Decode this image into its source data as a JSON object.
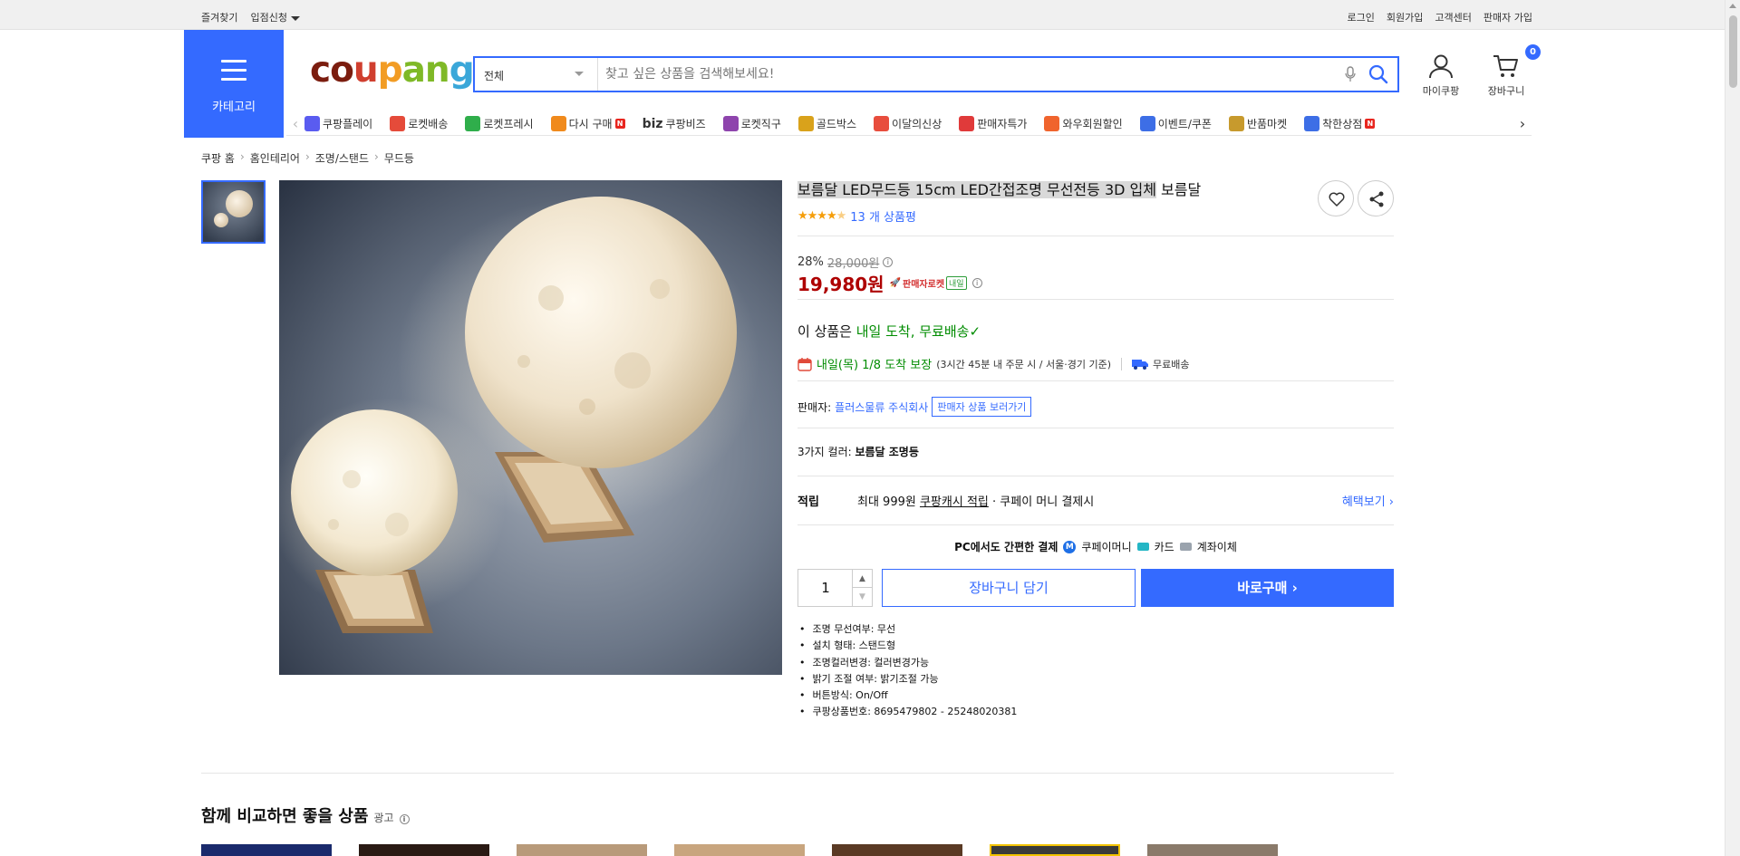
{
  "topbar": {
    "left": [
      "즐겨찾기",
      "입점신청"
    ],
    "right": [
      "로그인",
      "회원가입",
      "고객센터",
      "판매자 가입"
    ]
  },
  "header": {
    "category_label": "카테고리",
    "logo": {
      "c1": "co",
      "c2": "u",
      "c3": "p",
      "c4": "an",
      "c5": "g"
    },
    "search_category": "전체",
    "search_placeholder": "찾고 싶은 상품을 검색해보세요!",
    "my_coupang": "마이쿠팡",
    "cart": "장바구니",
    "cart_count": "0"
  },
  "shortcuts": [
    {
      "label": "쿠팡플레이",
      "icon": "play-icon",
      "color": "#5a5cf0"
    },
    {
      "label": "로켓배송",
      "icon": "rocket-icon",
      "color": "#e54b3a"
    },
    {
      "label": "로켓프레시",
      "icon": "rocket-fresh-icon",
      "color": "#2fae4b"
    },
    {
      "label": "다시 구매",
      "icon": "rebuy-icon",
      "color": "#f08a1c",
      "badge": "N"
    },
    {
      "label": "쿠팡비즈",
      "icon": "biz-icon",
      "color": "#333333",
      "biz": "biz"
    },
    {
      "label": "로켓직구",
      "icon": "rocket-global-icon",
      "color": "#8e44ad"
    },
    {
      "label": "골드박스",
      "icon": "goldbox-icon",
      "color": "#d9a21b"
    },
    {
      "label": "이달의신상",
      "icon": "new-icon",
      "color": "#e84d3d"
    },
    {
      "label": "판매자특가",
      "icon": "percent-icon",
      "color": "#e03a3a"
    },
    {
      "label": "와우회원할인",
      "icon": "wow-icon",
      "color": "#f0642d"
    },
    {
      "label": "이벤트/쿠폰",
      "icon": "coupon-icon",
      "color": "#3d6ee6"
    },
    {
      "label": "반품마켓",
      "icon": "return-market-icon",
      "color": "#c79a2d"
    },
    {
      "label": "착한상점",
      "icon": "good-store-icon",
      "color": "#3d6ee6",
      "badge": "N"
    }
  ],
  "breadcrumb": [
    "쿠팡 홈",
    "홈인테리어",
    "조명/스탠드",
    "무드등"
  ],
  "product": {
    "title_highlight": "보름달 LED무드등 15cm LED간접조명 무선전등 3D 입체",
    "title_rest": " 보름달",
    "review_count": "13 개 상품평",
    "rating": 4.5,
    "discount": "28%",
    "original_price": "28,000원",
    "price": "19,980원",
    "rocket_badge": "판매자로켓",
    "rocket_tomorrow": "내일",
    "arrival_prefix": "이 상품은 ",
    "arrival_green": "내일 도착, 무료배송",
    "delivery_date": "내일(목) 1/8 도착 보장",
    "delivery_condition": "(3시간 45분 내 주문 시 / 서울·경기 기준)",
    "free_shipping": "무료배송",
    "seller_label": "판매자: ",
    "seller_name": "플러스물류 주식회사",
    "seller_link": "판매자 상품 보러가기",
    "options_prefix": "3가지 컬러: ",
    "options_value": "보름달 조명등",
    "points_label": "적립",
    "points_text_1": "최대 999원 ",
    "points_text_link": "쿠팡캐시 적립",
    "points_text_2": " · 쿠페이 머니 결제시",
    "points_more": "혜택보기 ›",
    "pay_title": "PC에서도 간편한 결제",
    "pay_m": "M",
    "pay_money": "쿠페이머니",
    "pay_card": "카드",
    "pay_account": "계좌이체",
    "quantity": "1",
    "add_to_cart": "장바구니 담기",
    "buy_now": "바로구매 ›",
    "specs": [
      "조명 무선여부: 무선",
      "설치 형태: 스탠드형",
      "조명컬러변경: 컬러변경가능",
      "밝기 조절 여부: 밝기조절 가능",
      "버튼방식: On/Off",
      "쿠팡상품번호: 8695479802 - 25248020381"
    ]
  },
  "compare": {
    "title": "함께 비교하면 좋을 상품",
    "ad": "광고"
  },
  "colors": {
    "accent": "#346aff",
    "price": "#ae0000",
    "delivery_green": "#008c00"
  }
}
